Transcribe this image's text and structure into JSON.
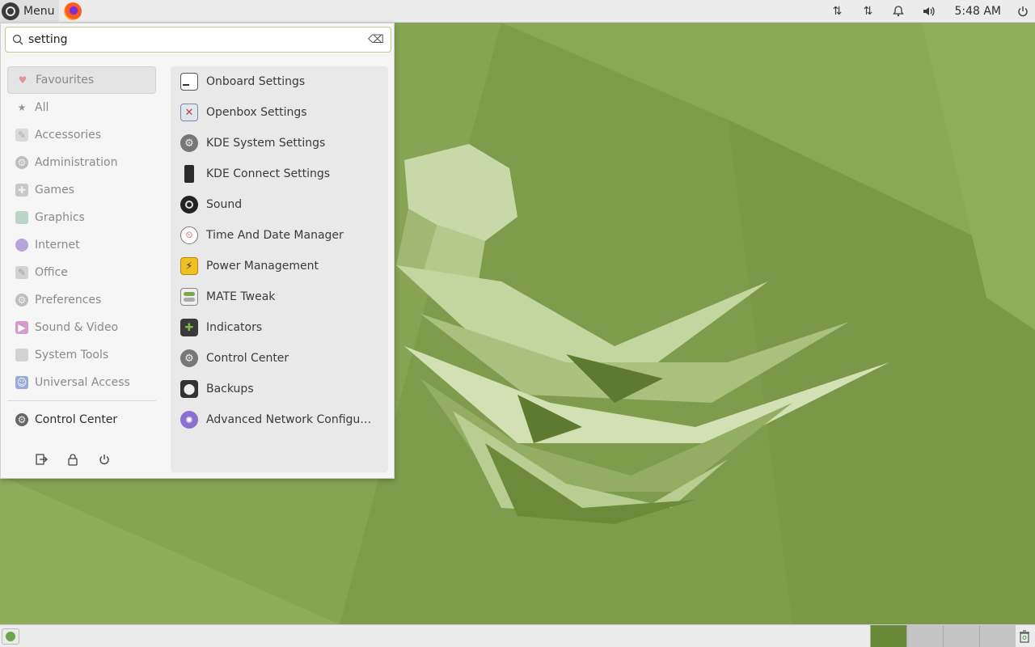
{
  "top_panel": {
    "menu_label": "Menu",
    "launchers": [
      "firefox-icon"
    ],
    "tray": [
      "network-transfer-icon",
      "network-transfer-icon",
      "notification-bell-icon",
      "volume-icon"
    ],
    "clock": "5:48 AM",
    "power_icon": "power-icon"
  },
  "menu": {
    "search": {
      "value": "setting",
      "placeholder": ""
    },
    "categories": [
      {
        "label": "Favourites",
        "icon": "heart-icon",
        "active": true
      },
      {
        "label": "All",
        "icon": "star-icon"
      },
      {
        "label": "Accessories",
        "icon": "accessories-icon"
      },
      {
        "label": "Administration",
        "icon": "administration-icon"
      },
      {
        "label": "Games",
        "icon": "games-icon"
      },
      {
        "label": "Graphics",
        "icon": "graphics-icon"
      },
      {
        "label": "Internet",
        "icon": "internet-icon"
      },
      {
        "label": "Office",
        "icon": "office-icon"
      },
      {
        "label": "Preferences",
        "icon": "preferences-icon"
      },
      {
        "label": "Sound & Video",
        "icon": "sound-video-icon"
      },
      {
        "label": "System Tools",
        "icon": "system-tools-icon"
      },
      {
        "label": "Universal Access",
        "icon": "universal-access-icon"
      }
    ],
    "pinned": {
      "label": "Control Center",
      "icon": "control-center-icon"
    },
    "session_buttons": [
      "logout-icon",
      "lock-icon",
      "power-icon"
    ],
    "results": [
      {
        "label": "Onboard Settings",
        "icon": "onboard-icon"
      },
      {
        "label": "Openbox Settings",
        "icon": "openbox-icon"
      },
      {
        "label": "KDE System Settings",
        "icon": "kde-settings-icon"
      },
      {
        "label": "KDE Connect Settings",
        "icon": "kde-connect-icon"
      },
      {
        "label": "Sound",
        "icon": "sound-icon"
      },
      {
        "label": "Time And Date Manager",
        "icon": "clock-icon"
      },
      {
        "label": "Power Management",
        "icon": "power-management-icon"
      },
      {
        "label": "MATE Tweak",
        "icon": "mate-tweak-icon"
      },
      {
        "label": "Indicators",
        "icon": "indicators-icon"
      },
      {
        "label": "Control Center",
        "icon": "control-center-icon"
      },
      {
        "label": "Backups",
        "icon": "backups-icon"
      },
      {
        "label": "Advanced Network Configu…",
        "icon": "network-icon"
      }
    ]
  },
  "bottom_panel": {
    "workspaces": 4,
    "active_workspace": 1
  },
  "colors": {
    "wallpaper": "#7c9a4a",
    "accent": "#9bbd5c"
  }
}
